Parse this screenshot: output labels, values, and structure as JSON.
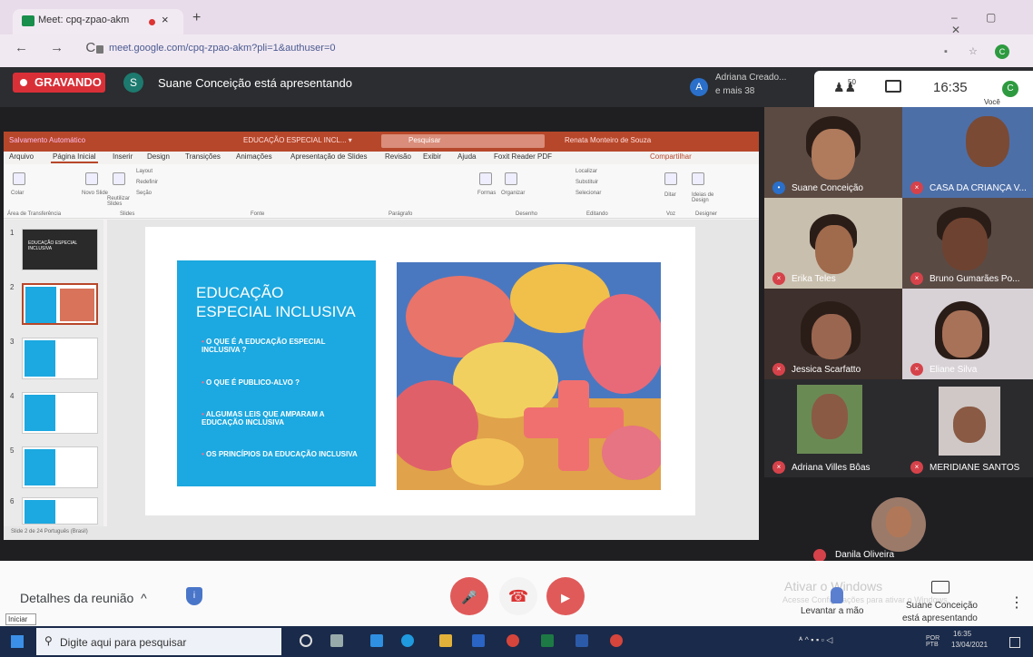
{
  "browser": {
    "tab_title": "Meet: cpq-zpao-akm",
    "new_tab": "+",
    "tab_close": "×",
    "window_controls": "– ▢ ✕",
    "nav": "← → C",
    "url": "meet.google.com/cpq-zpao-akm?pli=1&authuser=0",
    "extensions": "▪ ☆",
    "profile_initial": "C"
  },
  "meet_top": {
    "recording_label": "GRAVANDO",
    "presenter_initial": "S",
    "presenting_text": "Suane Conceição está apresentando",
    "participant_initial": "A",
    "participant_name": "Adriana Creado...",
    "participant_more": "e mais 38",
    "people_icon": "people-icon",
    "people_count": "50",
    "clock": "16:35",
    "you_initial": "C",
    "you_label": "Você"
  },
  "powerpoint": {
    "autosave": "Salvamento Automático",
    "doc_title": "EDUCAÇÃO ESPECIAL INCL... ▾",
    "search_placeholder": "Pesquisar",
    "user": "Renata Monteiro de Souza",
    "tabs": [
      "Arquivo",
      "Página Inicial",
      "Inserir",
      "Design",
      "Transições",
      "Animações",
      "Apresentação de Slides",
      "Revisão",
      "Exibir",
      "Ajuda",
      "Foxit Reader PDF"
    ],
    "share": "Compartilhar",
    "ribbon_groups": [
      "Área de Transferência",
      "Slides",
      "Fonte",
      "Parágrafo",
      "Desenho",
      "Editando",
      "Voz",
      "Designer"
    ],
    "ribbon_buttons": [
      "Colar",
      "Novo Slide",
      "Reutilizar Slides",
      "Layout",
      "Redefinir",
      "Seção",
      "Formas",
      "Organizar",
      "Localizar",
      "Substituir",
      "Selecionar",
      "Ditar",
      "Ideias de Design"
    ],
    "thumb_numbers": [
      "1",
      "2",
      "3",
      "4",
      "5",
      "6"
    ],
    "thumb1_title": "EDUCAÇÃO ESPECIAL INCLUSIVA",
    "slide": {
      "title_line1": "EDUCAÇÃO",
      "title_line2": "ESPECIAL INCLUSIVA",
      "bullets": [
        "O QUE É A EDUCAÇÃO  ESPECIAL INCLUSIVA ?",
        "O QUE É PUBLICO-ALVO  ?",
        "ALGUMAS  LEIS QUE AMPARAM  A EDUCAÇÃO INCLUSIVA",
        "OS PRINCÍPIOS DA EDUCAÇÃO INCLUSIVA"
      ],
      "bullet_glyph": "•"
    },
    "status": "Slide 2 de 24   Português (Brasil)"
  },
  "participants": [
    {
      "name": "Suane Conceição"
    },
    {
      "name": "CASA DA CRIANÇA V..."
    },
    {
      "name": "Erika Teles"
    },
    {
      "name": "Bruno Gumarães Po..."
    },
    {
      "name": "Jessica Scarfatto"
    },
    {
      "name": "Eliane Silva"
    },
    {
      "name": "Adriana Villes Bôas"
    },
    {
      "name": "MERIDIANE SANTOS"
    }
  ],
  "self_tile_name": "Danila Oliveira",
  "bottom": {
    "details_label": "Detalhes da reunião",
    "details_chevron": "^",
    "shield_glyph": "i",
    "mic_glyph": "🎤",
    "hangup_glyph": "☎",
    "cam_glyph": "▶",
    "watermark_title": "Ativar o Windows",
    "watermark_sub": "Acesse Configurações para ativar o Windows.",
    "raise_hand": "Levantar a mão",
    "presenter_name": "Suane Conceição",
    "presenter_status": "está apresentando",
    "more_glyph": "⋮",
    "tooltip": "Iniciar"
  },
  "taskbar": {
    "search_placeholder": "Digite aqui para pesquisar",
    "search_glyph": "⚲",
    "tray_text": "ᴬ ^ ▪ ▪ ▫ ◁",
    "lang": "POR PTB",
    "time": "16:35",
    "date": "13/04/2021"
  }
}
